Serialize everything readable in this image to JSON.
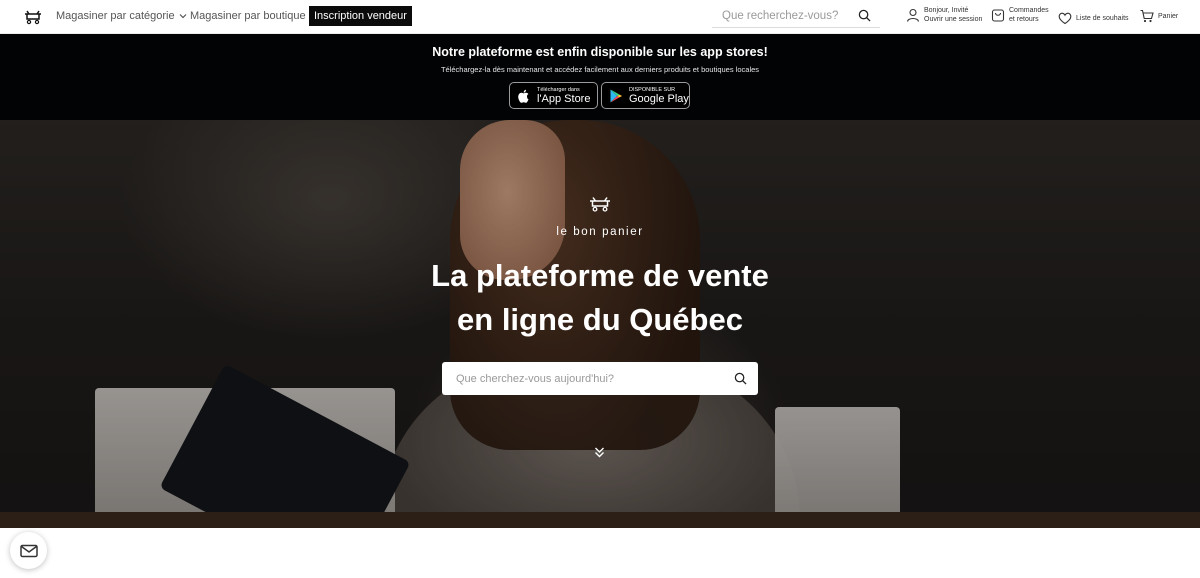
{
  "nav": {
    "logo_icon": "basket-logo-icon",
    "shop_by_category": "Magasiner par catégorie",
    "shop_by_store": "Magasiner par boutique",
    "vendor_signup": "Inscription vendeur",
    "search": {
      "placeholder": "Que recherchez-vous?"
    },
    "account": {
      "line1": "Bonjour, Invité",
      "line2": "Ouvrir une session"
    },
    "orders": {
      "line1": "Commandes",
      "line2": "et retours"
    },
    "wishlist": "Liste de souhaits",
    "cart": "Panier"
  },
  "app_banner": {
    "title": "Notre plateforme est enfin disponible sur les app stores!",
    "subtitle": "Téléchargez-la dès maintenant et accédez facilement aux derniers produits et boutiques locales",
    "app_store": {
      "small": "Télécharger dans",
      "big": "l'App Store"
    },
    "google_play": {
      "small": "DISPONIBLE SUR",
      "big": "Google Play"
    }
  },
  "hero": {
    "brand": "le bon panier",
    "title_line1": "La plateforme de vente",
    "title_line2": "en ligne du Québec",
    "search": {
      "placeholder": "Que cherchez-vous aujourd'hui?"
    }
  },
  "colors": {
    "dark": "#020305",
    "vendor_button": "#0b0b0b",
    "white": "#ffffff"
  }
}
